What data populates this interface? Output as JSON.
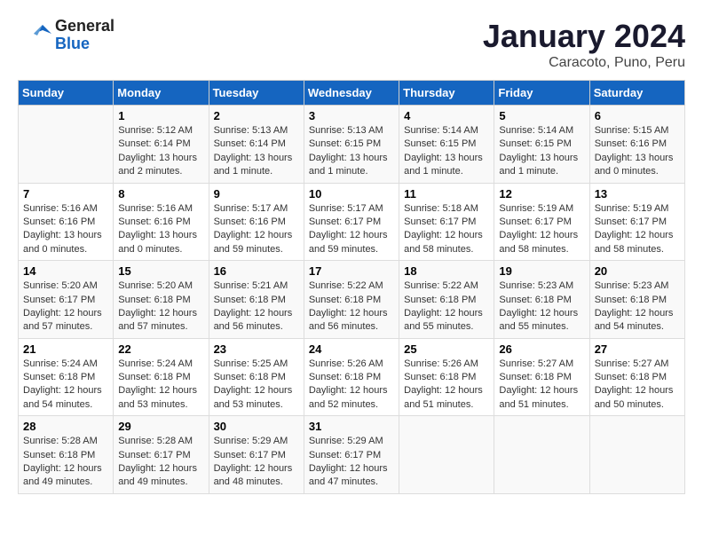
{
  "logo": {
    "general": "General",
    "blue": "Blue"
  },
  "title": "January 2024",
  "subtitle": "Caracoto, Puno, Peru",
  "headers": [
    "Sunday",
    "Monday",
    "Tuesday",
    "Wednesday",
    "Thursday",
    "Friday",
    "Saturday"
  ],
  "weeks": [
    [
      {
        "num": "",
        "sunrise": "",
        "sunset": "",
        "daylight": ""
      },
      {
        "num": "1",
        "sunrise": "Sunrise: 5:12 AM",
        "sunset": "Sunset: 6:14 PM",
        "daylight": "Daylight: 13 hours and 2 minutes."
      },
      {
        "num": "2",
        "sunrise": "Sunrise: 5:13 AM",
        "sunset": "Sunset: 6:14 PM",
        "daylight": "Daylight: 13 hours and 1 minute."
      },
      {
        "num": "3",
        "sunrise": "Sunrise: 5:13 AM",
        "sunset": "Sunset: 6:15 PM",
        "daylight": "Daylight: 13 hours and 1 minute."
      },
      {
        "num": "4",
        "sunrise": "Sunrise: 5:14 AM",
        "sunset": "Sunset: 6:15 PM",
        "daylight": "Daylight: 13 hours and 1 minute."
      },
      {
        "num": "5",
        "sunrise": "Sunrise: 5:14 AM",
        "sunset": "Sunset: 6:15 PM",
        "daylight": "Daylight: 13 hours and 1 minute."
      },
      {
        "num": "6",
        "sunrise": "Sunrise: 5:15 AM",
        "sunset": "Sunset: 6:16 PM",
        "daylight": "Daylight: 13 hours and 0 minutes."
      }
    ],
    [
      {
        "num": "7",
        "sunrise": "Sunrise: 5:16 AM",
        "sunset": "Sunset: 6:16 PM",
        "daylight": "Daylight: 13 hours and 0 minutes."
      },
      {
        "num": "8",
        "sunrise": "Sunrise: 5:16 AM",
        "sunset": "Sunset: 6:16 PM",
        "daylight": "Daylight: 13 hours and 0 minutes."
      },
      {
        "num": "9",
        "sunrise": "Sunrise: 5:17 AM",
        "sunset": "Sunset: 6:16 PM",
        "daylight": "Daylight: 12 hours and 59 minutes."
      },
      {
        "num": "10",
        "sunrise": "Sunrise: 5:17 AM",
        "sunset": "Sunset: 6:17 PM",
        "daylight": "Daylight: 12 hours and 59 minutes."
      },
      {
        "num": "11",
        "sunrise": "Sunrise: 5:18 AM",
        "sunset": "Sunset: 6:17 PM",
        "daylight": "Daylight: 12 hours and 58 minutes."
      },
      {
        "num": "12",
        "sunrise": "Sunrise: 5:19 AM",
        "sunset": "Sunset: 6:17 PM",
        "daylight": "Daylight: 12 hours and 58 minutes."
      },
      {
        "num": "13",
        "sunrise": "Sunrise: 5:19 AM",
        "sunset": "Sunset: 6:17 PM",
        "daylight": "Daylight: 12 hours and 58 minutes."
      }
    ],
    [
      {
        "num": "14",
        "sunrise": "Sunrise: 5:20 AM",
        "sunset": "Sunset: 6:17 PM",
        "daylight": "Daylight: 12 hours and 57 minutes."
      },
      {
        "num": "15",
        "sunrise": "Sunrise: 5:20 AM",
        "sunset": "Sunset: 6:18 PM",
        "daylight": "Daylight: 12 hours and 57 minutes."
      },
      {
        "num": "16",
        "sunrise": "Sunrise: 5:21 AM",
        "sunset": "Sunset: 6:18 PM",
        "daylight": "Daylight: 12 hours and 56 minutes."
      },
      {
        "num": "17",
        "sunrise": "Sunrise: 5:22 AM",
        "sunset": "Sunset: 6:18 PM",
        "daylight": "Daylight: 12 hours and 56 minutes."
      },
      {
        "num": "18",
        "sunrise": "Sunrise: 5:22 AM",
        "sunset": "Sunset: 6:18 PM",
        "daylight": "Daylight: 12 hours and 55 minutes."
      },
      {
        "num": "19",
        "sunrise": "Sunrise: 5:23 AM",
        "sunset": "Sunset: 6:18 PM",
        "daylight": "Daylight: 12 hours and 55 minutes."
      },
      {
        "num": "20",
        "sunrise": "Sunrise: 5:23 AM",
        "sunset": "Sunset: 6:18 PM",
        "daylight": "Daylight: 12 hours and 54 minutes."
      }
    ],
    [
      {
        "num": "21",
        "sunrise": "Sunrise: 5:24 AM",
        "sunset": "Sunset: 6:18 PM",
        "daylight": "Daylight: 12 hours and 54 minutes."
      },
      {
        "num": "22",
        "sunrise": "Sunrise: 5:24 AM",
        "sunset": "Sunset: 6:18 PM",
        "daylight": "Daylight: 12 hours and 53 minutes."
      },
      {
        "num": "23",
        "sunrise": "Sunrise: 5:25 AM",
        "sunset": "Sunset: 6:18 PM",
        "daylight": "Daylight: 12 hours and 53 minutes."
      },
      {
        "num": "24",
        "sunrise": "Sunrise: 5:26 AM",
        "sunset": "Sunset: 6:18 PM",
        "daylight": "Daylight: 12 hours and 52 minutes."
      },
      {
        "num": "25",
        "sunrise": "Sunrise: 5:26 AM",
        "sunset": "Sunset: 6:18 PM",
        "daylight": "Daylight: 12 hours and 51 minutes."
      },
      {
        "num": "26",
        "sunrise": "Sunrise: 5:27 AM",
        "sunset": "Sunset: 6:18 PM",
        "daylight": "Daylight: 12 hours and 51 minutes."
      },
      {
        "num": "27",
        "sunrise": "Sunrise: 5:27 AM",
        "sunset": "Sunset: 6:18 PM",
        "daylight": "Daylight: 12 hours and 50 minutes."
      }
    ],
    [
      {
        "num": "28",
        "sunrise": "Sunrise: 5:28 AM",
        "sunset": "Sunset: 6:18 PM",
        "daylight": "Daylight: 12 hours and 49 minutes."
      },
      {
        "num": "29",
        "sunrise": "Sunrise: 5:28 AM",
        "sunset": "Sunset: 6:17 PM",
        "daylight": "Daylight: 12 hours and 49 minutes."
      },
      {
        "num": "30",
        "sunrise": "Sunrise: 5:29 AM",
        "sunset": "Sunset: 6:17 PM",
        "daylight": "Daylight: 12 hours and 48 minutes."
      },
      {
        "num": "31",
        "sunrise": "Sunrise: 5:29 AM",
        "sunset": "Sunset: 6:17 PM",
        "daylight": "Daylight: 12 hours and 47 minutes."
      },
      {
        "num": "",
        "sunrise": "",
        "sunset": "",
        "daylight": ""
      },
      {
        "num": "",
        "sunrise": "",
        "sunset": "",
        "daylight": ""
      },
      {
        "num": "",
        "sunrise": "",
        "sunset": "",
        "daylight": ""
      }
    ]
  ]
}
